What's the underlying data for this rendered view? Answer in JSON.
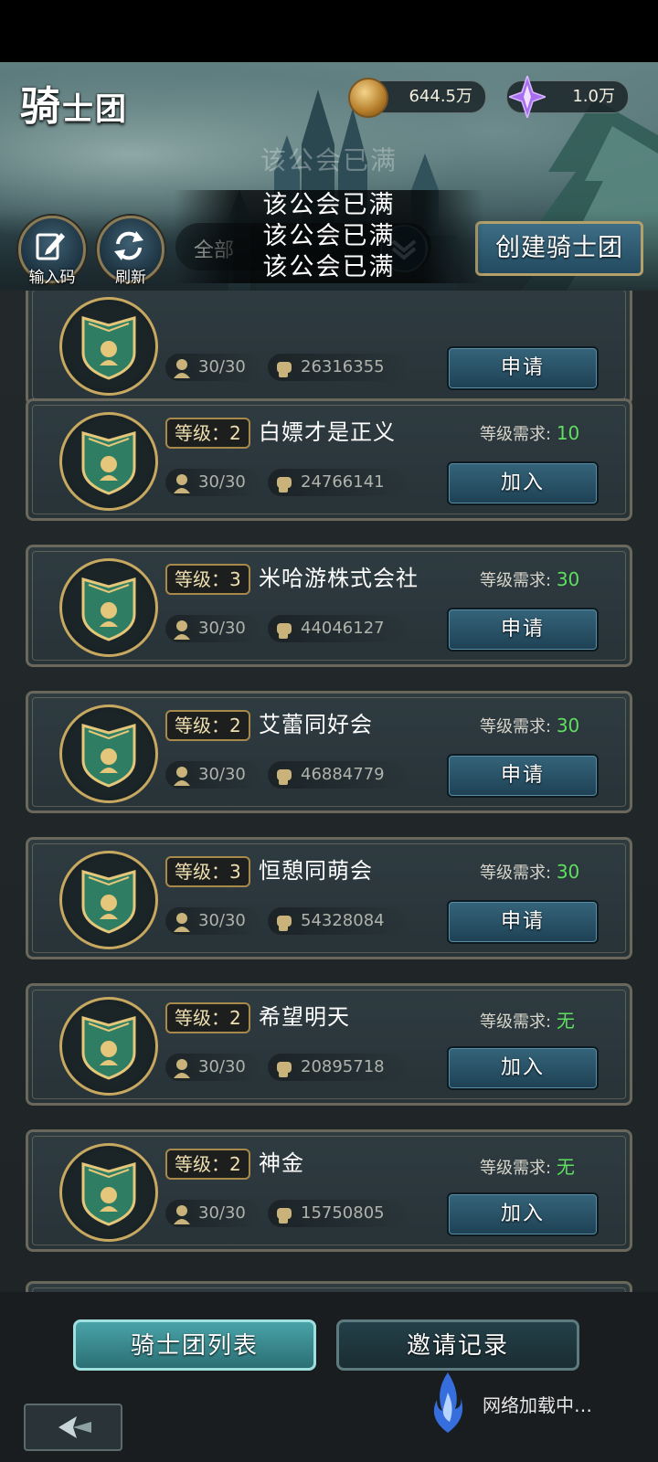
{
  "header": {
    "title_main": "骑",
    "title_rest": "士团",
    "gold": "644.5万",
    "gems": "1.0万",
    "faded_notice": "该公会已满",
    "toasts": [
      "该公会已满",
      "该公会已满",
      "该公会已满"
    ],
    "input_code_label": "输入码",
    "refresh_label": "刷新",
    "filter_value": "全部",
    "create_label": "创建骑士团"
  },
  "guilds": [
    {
      "level_label": "",
      "name": "",
      "requirement_label": "",
      "requirement_value": "",
      "members": "30/30",
      "power": "26316355",
      "action": "申请"
    },
    {
      "level_label": "等级：2",
      "name": "白嫖才是正义",
      "requirement_label": "等级需求:",
      "requirement_value": "10",
      "members": "30/30",
      "power": "24766141",
      "action": "加入"
    },
    {
      "level_label": "等级：3",
      "name": "米哈游株式会社",
      "requirement_label": "等级需求:",
      "requirement_value": "30",
      "members": "30/30",
      "power": "44046127",
      "action": "申请"
    },
    {
      "level_label": "等级：2",
      "name": "艾蕾同好会",
      "requirement_label": "等级需求:",
      "requirement_value": "30",
      "members": "30/30",
      "power": "46884779",
      "action": "申请"
    },
    {
      "level_label": "等级：3",
      "name": "恒憩同萌会",
      "requirement_label": "等级需求:",
      "requirement_value": "30",
      "members": "30/30",
      "power": "54328084",
      "action": "申请"
    },
    {
      "level_label": "等级：2",
      "name": "希望明天",
      "requirement_label": "等级需求:",
      "requirement_value": "无",
      "members": "30/30",
      "power": "20895718",
      "action": "加入"
    },
    {
      "level_label": "等级：2",
      "name": "神金",
      "requirement_label": "等级需求:",
      "requirement_value": "无",
      "members": "30/30",
      "power": "15750805",
      "action": "加入"
    }
  ],
  "tabs": {
    "active": "骑士团列表",
    "inactive": "邀请记录"
  },
  "status": {
    "loading": "网络加载中…"
  },
  "icons": {
    "gold": "gold-coin-icon",
    "gem": "purple-gem-icon",
    "edit": "edit-icon",
    "refresh": "refresh-icon",
    "members": "members-icon",
    "power": "power-fist-icon",
    "back": "back-arrow-icon",
    "emblem": "guild-shield-emblem"
  },
  "colors": {
    "requirement_value": "#5fde5f",
    "badge_border": "#a7894b",
    "active_tab": "#49a3a8"
  }
}
